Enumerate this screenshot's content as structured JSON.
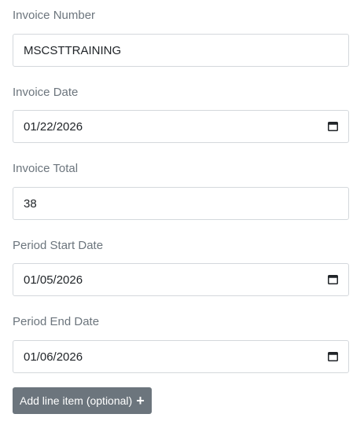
{
  "fields": [
    {
      "label": "Invoice Number",
      "value": "MSCSTTRAINING",
      "type": "text"
    },
    {
      "label": "Invoice Date",
      "value": "01/22/2026",
      "type": "date",
      "icon": "calendar-icon"
    },
    {
      "label": "Invoice Total",
      "value": "38",
      "type": "number"
    },
    {
      "label": "Period Start Date",
      "value": "01/05/2026",
      "type": "date",
      "icon": "calendar-icon"
    },
    {
      "label": "Period End Date",
      "value": "01/06/2026",
      "type": "date",
      "icon": "calendar-icon"
    }
  ],
  "add_button": {
    "label": "Add line item (optional)",
    "icon": "plus-icon",
    "icon_glyph": "+"
  },
  "colors": {
    "button_bg": "#6c757d",
    "label": "#6c757d",
    "border": "#d4d8dc"
  }
}
